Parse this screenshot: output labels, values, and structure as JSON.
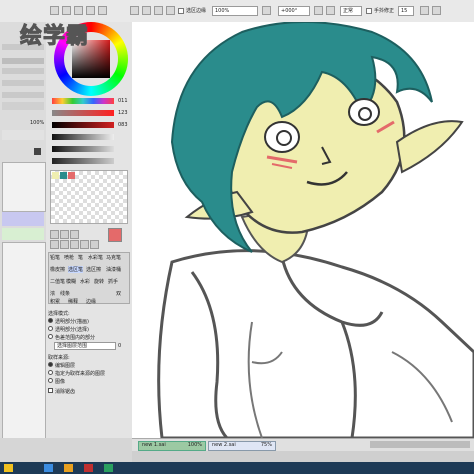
{
  "watermark_logo": "绘学霸",
  "toolbar": {
    "check_label": "选区边缘",
    "zoom_value": "100%",
    "angle_value": "+000°",
    "mode_value": "正常",
    "stabilizer_label": "手抖修正",
    "stabilizer_value": "15"
  },
  "left_panel": {
    "value_100": "100%"
  },
  "color": {
    "slider_values": [
      "011",
      "123",
      "083"
    ],
    "accent_hex": "#e46a6a",
    "teal_hex": "#2a8c8c",
    "skin_hex": "#f0eeb0"
  },
  "tools": {
    "labels": [
      "铅笔",
      "喷枪",
      "笔",
      "水彩笔",
      "马克笔",
      "橡皮擦",
      "选区笔",
      "选区擦",
      "油漆桶",
      "二值笔",
      "模糊",
      "水彩",
      "旋转",
      "抓手"
    ],
    "row3": [
      "浓",
      "线条",
      "",
      "",
      "",
      "",
      "双"
    ],
    "row4": [
      "积累",
      "稀释",
      "边缘"
    ]
  },
  "options": {
    "title": "选择模式:",
    "opt1": "透明部分(描画)",
    "opt2": "透明部分(选择)",
    "opt3": "色差范围内的部分",
    "range_label": "选择图层范围",
    "range_value": "0",
    "target_title": "取样来源:",
    "target_opt1": "编辑图层",
    "target_opt2": "指定为取样来源的图层",
    "target_opt3": "图像",
    "anti_label": "消除锯齿"
  },
  "bottom": {
    "file1": "new 1.sai",
    "zoom1": "100%",
    "file2": "new 2.sai",
    "zoom2": "75%"
  }
}
